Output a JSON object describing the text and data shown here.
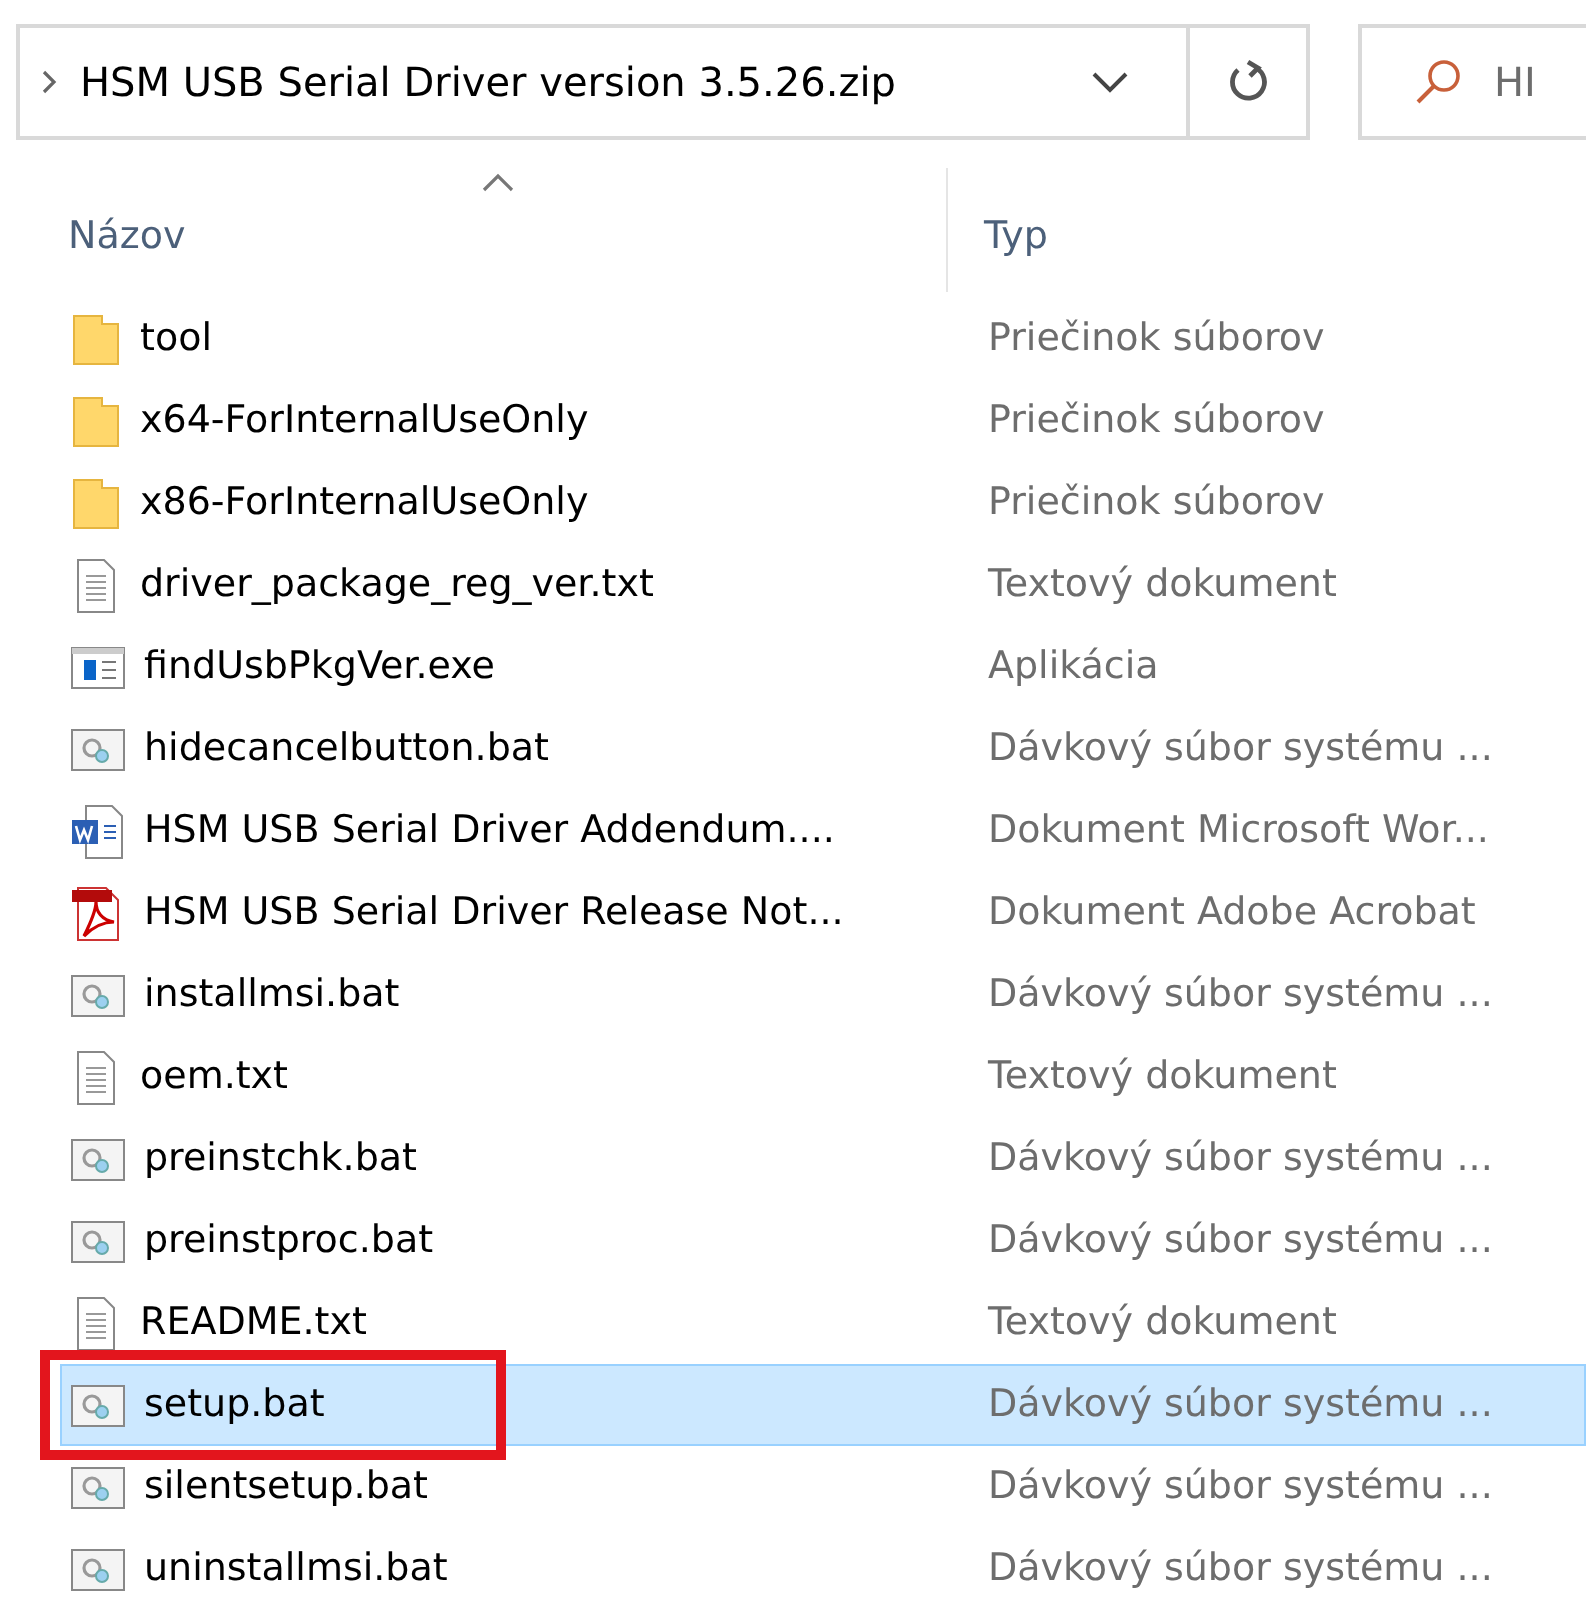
{
  "address_bar": {
    "path": "HSM USB Serial Driver version 3.5.26.zip"
  },
  "search": {
    "placeholder": "HI"
  },
  "columns": [
    {
      "label": "Názov",
      "sorted": true
    },
    {
      "label": "Typ",
      "sorted": false
    }
  ],
  "rows": [
    {
      "name": "tool",
      "type": "Priečinok súborov",
      "kind": "folder",
      "selected": false,
      "annotated": false
    },
    {
      "name": "x64-ForInternalUseOnly",
      "type": "Priečinok súborov",
      "kind": "folder",
      "selected": false,
      "annotated": false
    },
    {
      "name": "x86-ForInternalUseOnly",
      "type": "Priečinok súborov",
      "kind": "folder",
      "selected": false,
      "annotated": false
    },
    {
      "name": "driver_package_reg_ver.txt",
      "type": "Textový dokument",
      "kind": "text",
      "selected": false,
      "annotated": false
    },
    {
      "name": "findUsbPkgVer.exe",
      "type": "Aplikácia",
      "kind": "exe",
      "selected": false,
      "annotated": false
    },
    {
      "name": "hidecancelbutton.bat",
      "type": "Dávkový súbor systému ...",
      "kind": "batch",
      "selected": false,
      "annotated": false
    },
    {
      "name": "HSM USB Serial Driver Addendum....",
      "type": "Dokument Microsoft Wor...",
      "kind": "word",
      "selected": false,
      "annotated": false
    },
    {
      "name": "HSM USB Serial Driver Release Not...",
      "type": "Dokument Adobe Acrobat",
      "kind": "pdf",
      "selected": false,
      "annotated": false
    },
    {
      "name": "installmsi.bat",
      "type": "Dávkový súbor systému ...",
      "kind": "batch",
      "selected": false,
      "annotated": false
    },
    {
      "name": "oem.txt",
      "type": "Textový dokument",
      "kind": "text",
      "selected": false,
      "annotated": false
    },
    {
      "name": "preinstchk.bat",
      "type": "Dávkový súbor systému ...",
      "kind": "batch",
      "selected": false,
      "annotated": false
    },
    {
      "name": "preinstproc.bat",
      "type": "Dávkový súbor systému ...",
      "kind": "batch",
      "selected": false,
      "annotated": false
    },
    {
      "name": "README.txt",
      "type": "Textový dokument",
      "kind": "text",
      "selected": false,
      "annotated": false
    },
    {
      "name": "setup.bat",
      "type": "Dávkový súbor systému ...",
      "kind": "batch",
      "selected": true,
      "annotated": true
    },
    {
      "name": "silentsetup.bat",
      "type": "Dávkový súbor systému ...",
      "kind": "batch",
      "selected": false,
      "annotated": false
    },
    {
      "name": "uninstallmsi.bat",
      "type": "Dávkový súbor systému ...",
      "kind": "batch",
      "selected": false,
      "annotated": false
    }
  ]
}
